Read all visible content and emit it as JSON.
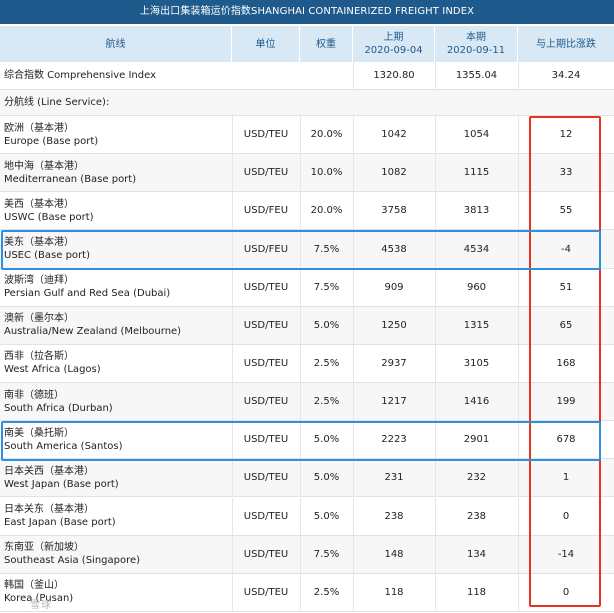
{
  "title": "上海出口集装箱运价指数SHANGHAI CONTAINERIZED FREIGHT INDEX",
  "headers": {
    "route": "航线",
    "unit": "单位",
    "weight": "权重",
    "prev_line1": "上期",
    "prev_line2": "2020-09-04",
    "curr_line1": "本期",
    "curr_line2": "2020-09-11",
    "change": "与上期比涨跌"
  },
  "composite": {
    "label": "综合指数 Comprehensive Index",
    "prev": "1320.80",
    "curr": "1355.04",
    "change": "34.24"
  },
  "section_label": "分航线 (Line Service):",
  "rows": [
    {
      "cn": "欧洲（基本港）",
      "en": "Europe (Base port)",
      "unit": "USD/TEU",
      "weight": "20.0%",
      "prev": "1042",
      "curr": "1054",
      "change": "12"
    },
    {
      "cn": "地中海（基本港）",
      "en": "Mediterranean (Base port)",
      "unit": "USD/TEU",
      "weight": "10.0%",
      "prev": "1082",
      "curr": "1115",
      "change": "33"
    },
    {
      "cn": "美西（基本港）",
      "en": "USWC (Base port)",
      "unit": "USD/FEU",
      "weight": "20.0%",
      "prev": "3758",
      "curr": "3813",
      "change": "55"
    },
    {
      "cn": "美东（基本港）",
      "en": "USEC (Base port)",
      "unit": "USD/FEU",
      "weight": "7.5%",
      "prev": "4538",
      "curr": "4534",
      "change": "-4"
    },
    {
      "cn": "波斯湾（迪拜）",
      "en": "Persian Gulf and Red Sea (Dubai)",
      "unit": "USD/TEU",
      "weight": "7.5%",
      "prev": "909",
      "curr": "960",
      "change": "51"
    },
    {
      "cn": "澳新（墨尔本）",
      "en": "Australia/New Zealand (Melbourne)",
      "unit": "USD/TEU",
      "weight": "5.0%",
      "prev": "1250",
      "curr": "1315",
      "change": "65"
    },
    {
      "cn": "西非（拉各斯）",
      "en": "West Africa (Lagos)",
      "unit": "USD/TEU",
      "weight": "2.5%",
      "prev": "2937",
      "curr": "3105",
      "change": "168"
    },
    {
      "cn": "南非（德班）",
      "en": "South Africa (Durban)",
      "unit": "USD/TEU",
      "weight": "2.5%",
      "prev": "1217",
      "curr": "1416",
      "change": "199"
    },
    {
      "cn": "南美（桑托斯）",
      "en": "South America (Santos)",
      "unit": "USD/TEU",
      "weight": "5.0%",
      "prev": "2223",
      "curr": "2901",
      "change": "678"
    },
    {
      "cn": "日本关西（基本港）",
      "en": "West Japan (Base port)",
      "unit": "USD/TEU",
      "weight": "5.0%",
      "prev": "231",
      "curr": "232",
      "change": "1"
    },
    {
      "cn": "日本关东（基本港）",
      "en": "East Japan (Base port)",
      "unit": "USD/TEU",
      "weight": "5.0%",
      "prev": "238",
      "curr": "238",
      "change": "0"
    },
    {
      "cn": "东南亚（新加坡）",
      "en": "Southeast Asia (Singapore)",
      "unit": "USD/TEU",
      "weight": "7.5%",
      "prev": "148",
      "curr": "134",
      "change": "-14"
    },
    {
      "cn": "韩国（釜山）",
      "en": "Korea (Pusan)",
      "unit": "USD/TEU",
      "weight": "2.5%",
      "prev": "118",
      "curr": "118",
      "change": "0"
    }
  ],
  "colors": {
    "header_bar": "#1e5a8c",
    "header_cells": "#d9e8f5",
    "highlight_red": "#e53322",
    "highlight_blue": "#2e8fe0"
  },
  "watermark": "雪球"
}
